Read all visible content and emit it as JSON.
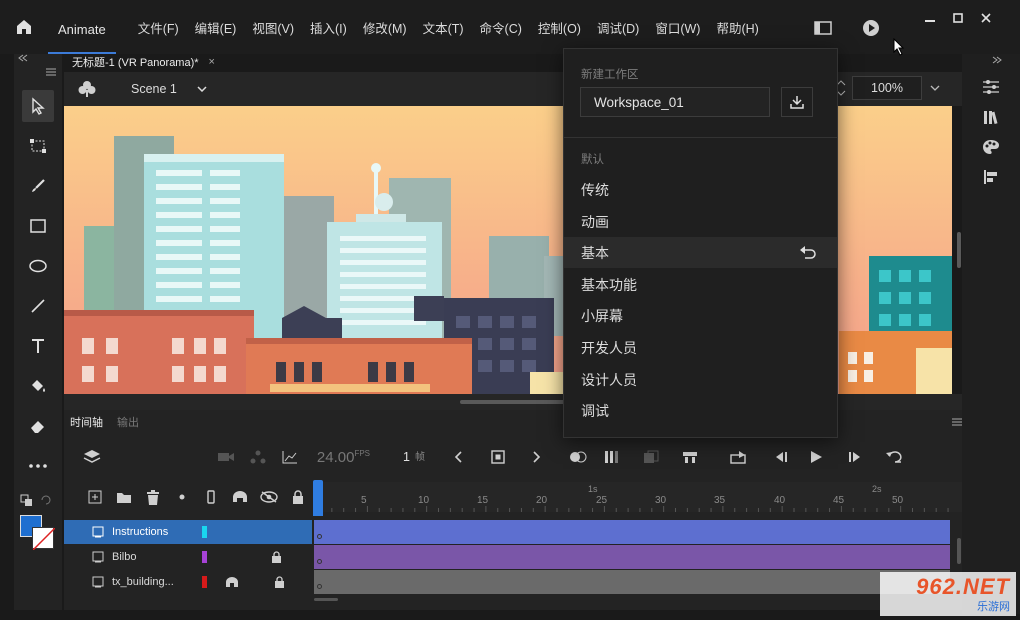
{
  "app": {
    "name": "Animate"
  },
  "menu": [
    "文件(F)",
    "编辑(E)",
    "视图(V)",
    "插入(I)",
    "修改(M)",
    "文本(T)",
    "命令(C)",
    "控制(O)",
    "调试(D)",
    "窗口(W)",
    "帮助(H)"
  ],
  "document": {
    "tab_title": "无标题-1 (VR Panorama)*",
    "close": "×"
  },
  "scene": {
    "name": "Scene 1"
  },
  "zoom": {
    "value": "100%"
  },
  "workspace_popup": {
    "new_label": "新建工作区",
    "input_value": "Workspace_01",
    "default_label": "默认",
    "items": [
      "传统",
      "动画",
      "基本",
      "基本功能",
      "小屏幕",
      "开发人员",
      "设计人员",
      "调试"
    ],
    "active_item": "基本"
  },
  "timeline": {
    "tabs": [
      "时间轴",
      "输出"
    ],
    "fps_value": "24.00",
    "fps_unit": "FPS",
    "current_frame": "1",
    "frame_unit": "帧",
    "ruler_ticks": [
      "5",
      "10",
      "15",
      "20",
      "25",
      "30",
      "35",
      "40",
      "45",
      "50"
    ],
    "ruler_seconds": [
      "1s",
      "2s"
    ],
    "layers": [
      {
        "name": "Instructions",
        "color": "#19d6f0",
        "selected": true,
        "frame_color": "#5d6fd0"
      },
      {
        "name": "Bilbo",
        "color": "#a642d6",
        "selected": false,
        "frame_color": "#7a56a8",
        "locked": true
      },
      {
        "name": "tx_building...",
        "color": "#d61a1a",
        "selected": false,
        "frame_color": "#7a7a7a",
        "locked": true
      }
    ]
  },
  "watermark": {
    "main": "962.NET",
    "sub": "乐游网"
  },
  "colors": {
    "accent": "#2f7de1",
    "stroke": "#1f6fd0",
    "fill": "#ffffff"
  }
}
